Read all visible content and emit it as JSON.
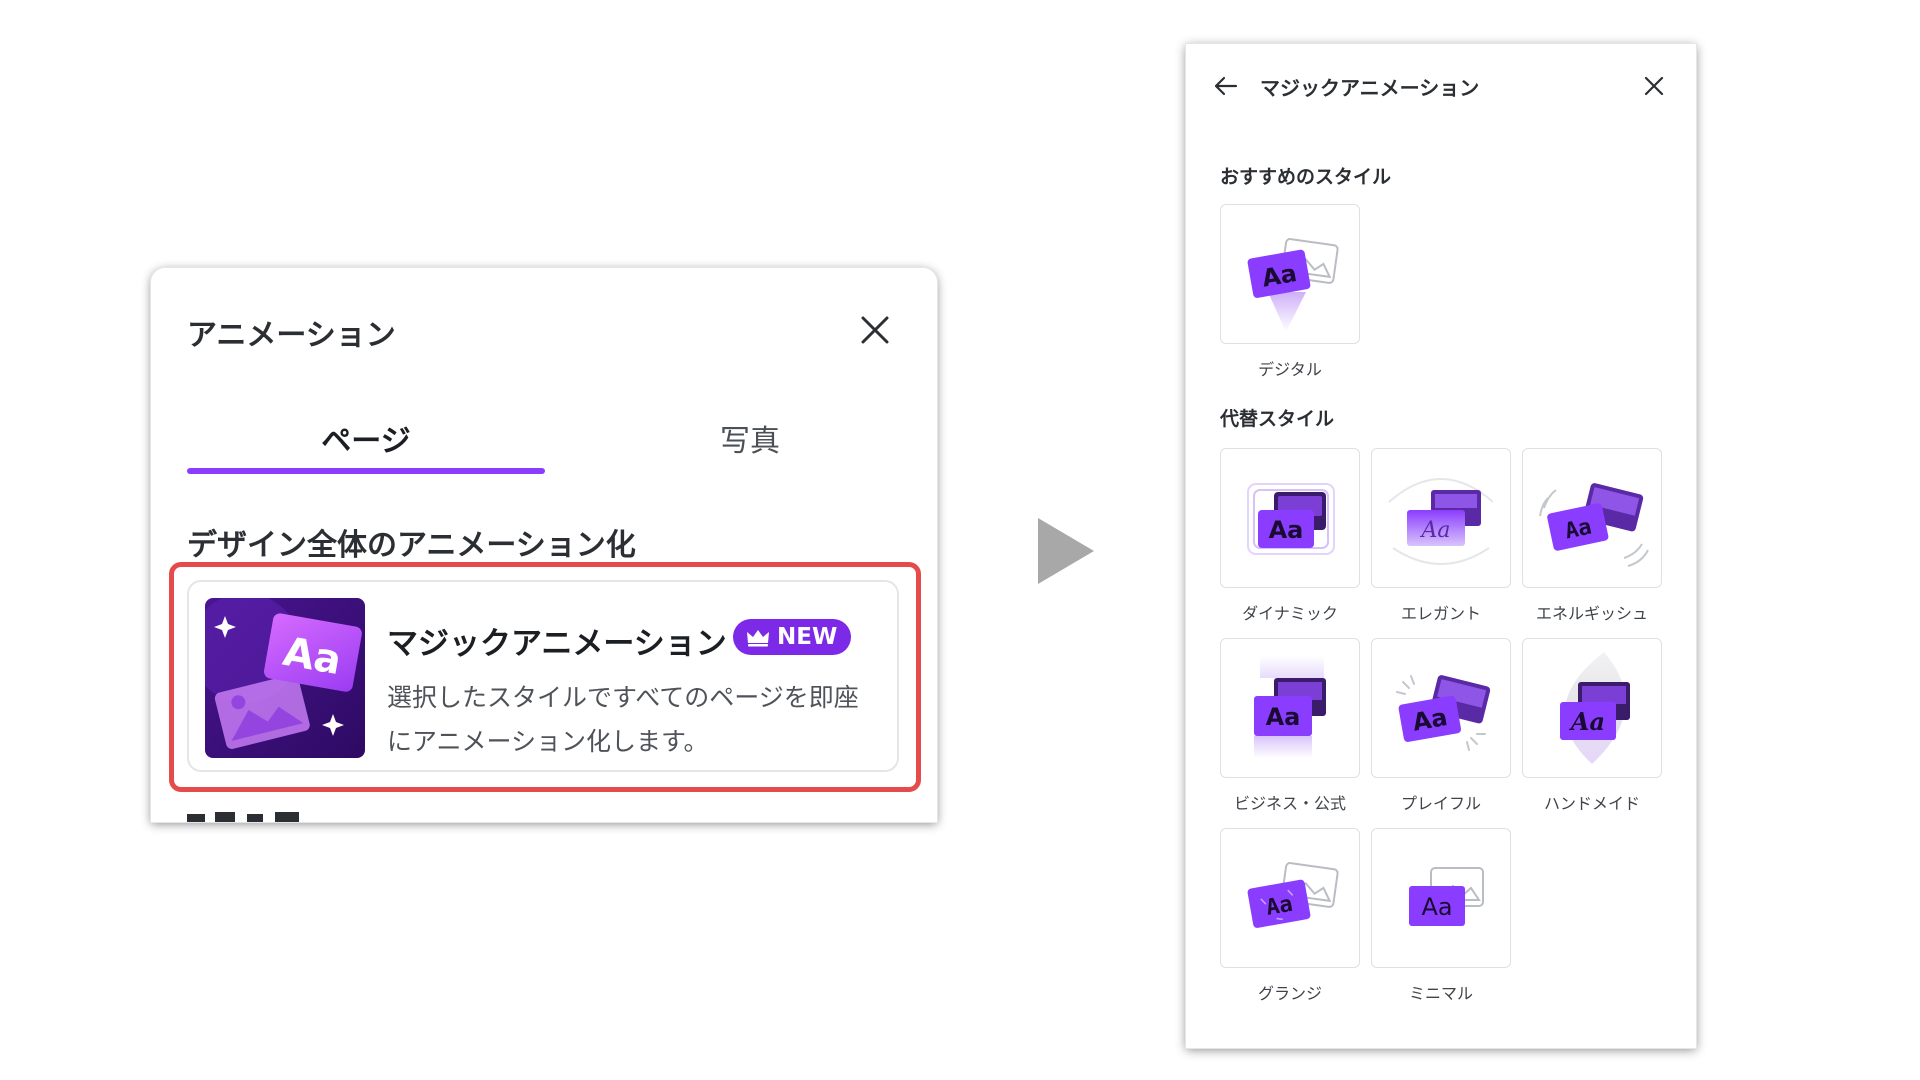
{
  "left_panel": {
    "title": "アニメーション",
    "tabs": [
      {
        "label": "ページ",
        "active": true
      },
      {
        "label": "写真",
        "active": false
      }
    ],
    "section_title": "デザイン全体のアニメーション化",
    "card": {
      "title": "マジックアニメーション",
      "badge": "NEW",
      "description_line1": "選択したスタイルですべてのページを即座",
      "description_line2": "にアニメーション化します。"
    }
  },
  "right_panel": {
    "title": "マジックアニメーション",
    "recommended_heading": "おすすめのスタイル",
    "recommended": [
      {
        "label": "デジタル",
        "icon": "digital-style-icon"
      }
    ],
    "alternatives_heading": "代替スタイル",
    "alternatives": [
      {
        "label": "ダイナミック",
        "icon": "dynamic-style-icon"
      },
      {
        "label": "エレガント",
        "icon": "elegant-style-icon"
      },
      {
        "label": "エネルギッシュ",
        "icon": "energetic-style-icon"
      },
      {
        "label": "ビジネス・公式",
        "icon": "business-style-icon"
      },
      {
        "label": "プレイフル",
        "icon": "playful-style-icon"
      },
      {
        "label": "ハンドメイド",
        "icon": "handmade-style-icon"
      },
      {
        "label": "グランジ",
        "icon": "grunge-style-icon"
      },
      {
        "label": "ミニマル",
        "icon": "minimal-style-icon"
      }
    ]
  },
  "colors": {
    "accent_purple": "#8b3dff",
    "badge_purple": "#7d2ae8",
    "highlight_red": "#e54b4b"
  }
}
